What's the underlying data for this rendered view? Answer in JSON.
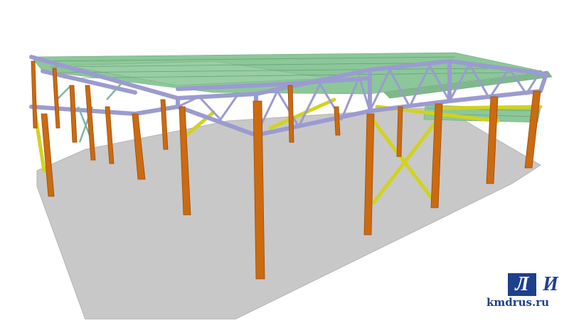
{
  "scene": {
    "colors": {
      "background": "#ffffff",
      "floor": "#c8c8c8",
      "column": "#cc6a10",
      "brace": "#d2d21e",
      "truss": "#9b9bd0",
      "purlin": "#8cc79a",
      "secondary_brace": "#7fb5a8"
    }
  },
  "logo": {
    "letter_1": "Л",
    "letter_2": "И",
    "url": "kmdrus.ru"
  }
}
